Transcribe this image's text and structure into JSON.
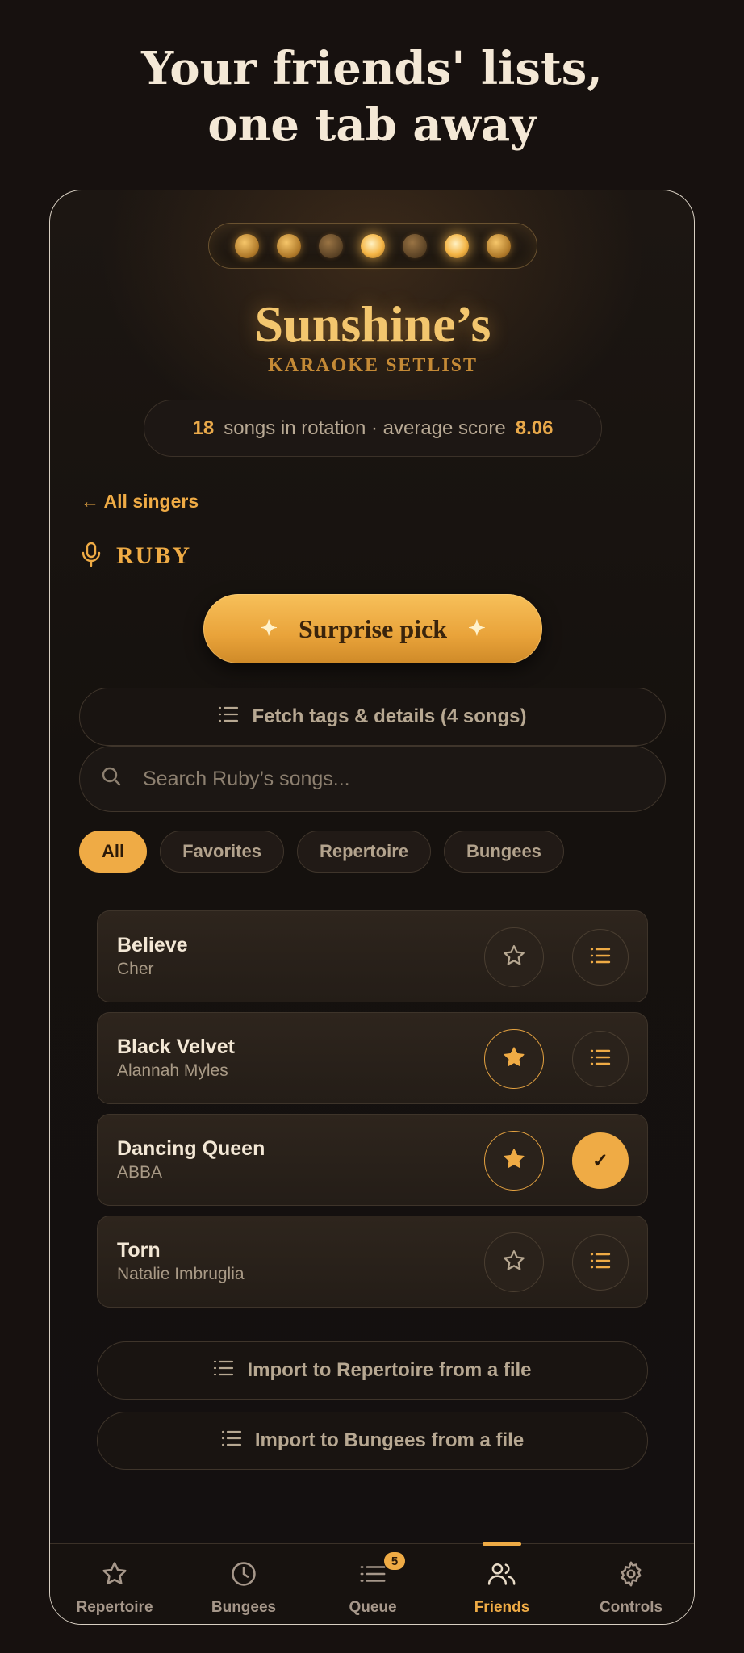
{
  "headline": {
    "line1": "Your friends' lists,",
    "line2": "one tab away"
  },
  "brand": {
    "title": "Sunshine’s",
    "subtitle": "KARAOKE SETLIST"
  },
  "stats": {
    "songs": "18",
    "label": "songs in rotation · average score",
    "score": "8.06"
  },
  "nav": {
    "back_label": "← All singers"
  },
  "singer": {
    "name": "RUBY",
    "icon": "microphone-icon"
  },
  "actions": {
    "surprise_label": "Surprise pick",
    "fetch_label": "Fetch tags & details (4 songs)"
  },
  "search": {
    "placeholder": "Search Ruby’s songs..."
  },
  "filters": [
    "All",
    "Favorites",
    "Repertoire",
    "Bungees"
  ],
  "songs": [
    {
      "title": "Believe",
      "artist": "Cher",
      "favorite": false,
      "in_list": false
    },
    {
      "title": "Black Velvet",
      "artist": "Alannah Myles",
      "favorite": true,
      "in_list": false
    },
    {
      "title": "Dancing Queen",
      "artist": "ABBA",
      "favorite": true,
      "in_list": true,
      "check": "✓"
    },
    {
      "title": "Torn",
      "artist": "Natalie Imbruglia",
      "favorite": false,
      "in_list": false
    }
  ],
  "imports": {
    "repertoire_label": "Import to Repertoire from a file",
    "bungees_label": "Import to Bungees from a file"
  },
  "tabs": [
    {
      "label": "Repertoire",
      "icon": "star-icon"
    },
    {
      "label": "Bungees",
      "icon": "clock-icon"
    },
    {
      "label": "Queue",
      "icon": "list-icon",
      "badge": "5"
    },
    {
      "label": "Friends",
      "icon": "users-icon",
      "active": true
    },
    {
      "label": "Controls",
      "icon": "gear-icon"
    }
  ],
  "colors": {
    "accent": "#efab45",
    "background": "#17110f",
    "card": "#2a221b"
  }
}
